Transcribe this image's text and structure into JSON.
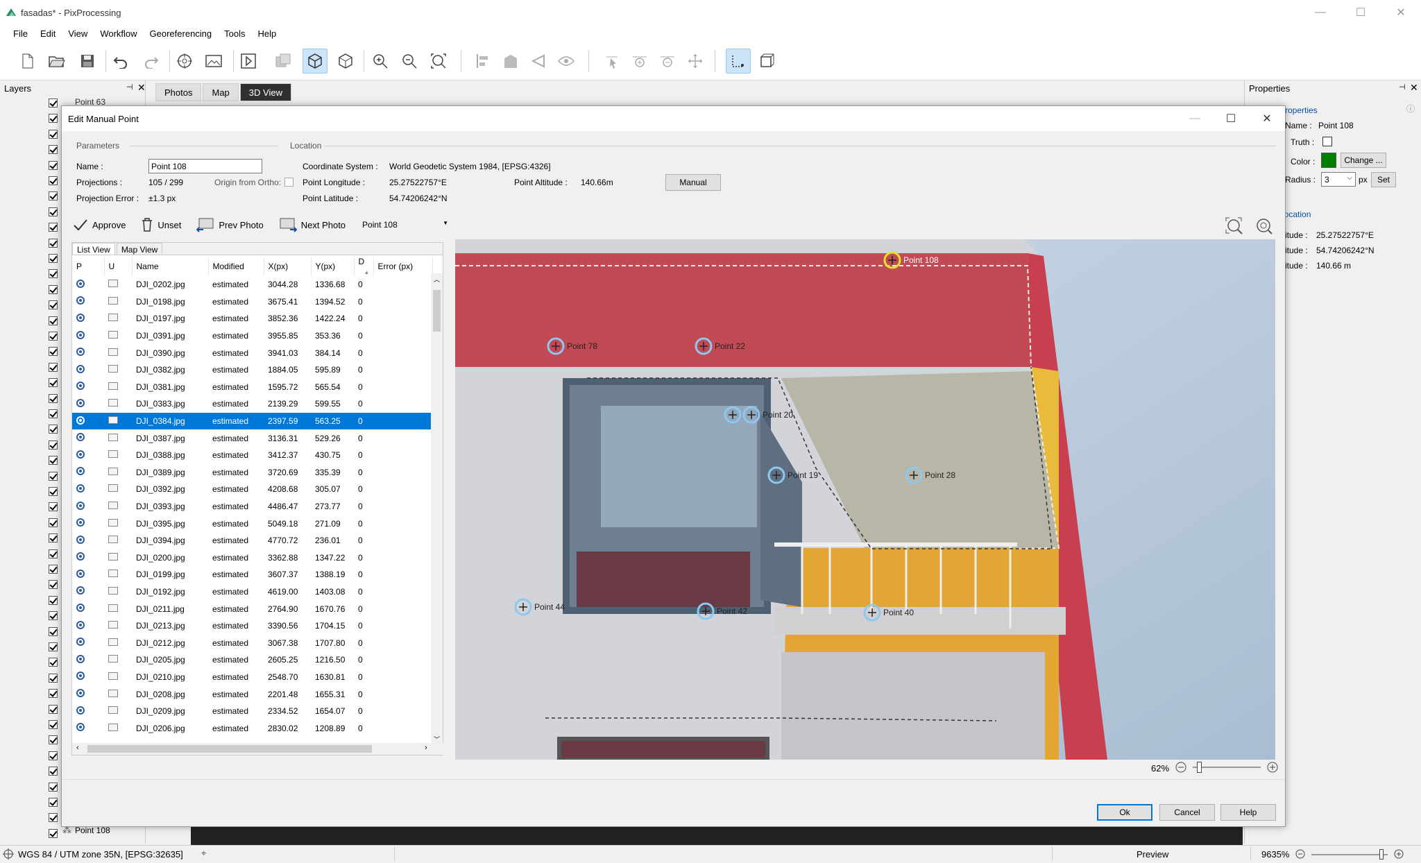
{
  "window": {
    "title": "fasadas* - PixProcessing",
    "min": "—",
    "max": "☐",
    "close": "✕"
  },
  "menu": [
    "File",
    "Edit",
    "View",
    "Workflow",
    "Georeferencing",
    "Tools",
    "Help"
  ],
  "layers": {
    "title": "Layers",
    "top_item": "Point 63",
    "bottom_item": "Point 108"
  },
  "view_tabs": [
    "Photos",
    "Map",
    "3D View"
  ],
  "properties": {
    "title": "Properties",
    "section": "Properties",
    "name_label": "Name :",
    "name_value": "Point 108",
    "truth_label": "Truth :",
    "color_label": "Color :",
    "color": "#008000",
    "change_label": "Change ...",
    "radius_label": "Radius :",
    "radius_value": "3",
    "radius_unit": "px",
    "set_label": "Set",
    "location_section": "Location",
    "lon_label": "itude :",
    "lon_value": "25.27522757°E",
    "lat_label": "itude :",
    "lat_value": "54.74206242°N",
    "alt_label": "itude :",
    "alt_value": "140.66 m"
  },
  "dialog": {
    "title": "Edit Manual Point",
    "parameters_label": "Parameters",
    "location_label": "Location",
    "name_label": "Name :",
    "name_value": "Point 108",
    "projections_label": "Projections :",
    "projections_value": "105 / 299",
    "origin_label": "Origin from Ortho:",
    "proj_error_label": "Projection Error :",
    "proj_error_value": "±1.3 px",
    "cs_label": "Coordinate System :",
    "cs_value": "World Geodetic System 1984, [EPSG:4326]",
    "lon_label": "Point Longitude :",
    "lon_value": "25.27522757°E",
    "lat_label": "Point Latitude :",
    "lat_value": "54.74206242°N",
    "alt_label": "Point Altitude :",
    "alt_value": "140.66m",
    "manual_button": "Manual",
    "approve": "Approve",
    "unset": "Unset",
    "prev_photo": "Prev Photo",
    "next_photo": "Next Photo",
    "point_select": "Point 108",
    "list_tabs": [
      "List View",
      "Map View"
    ],
    "columns": [
      "P",
      "U",
      "Name",
      "Modified",
      "X(px)",
      "Y(px)",
      "D",
      "Error (px)"
    ],
    "rows": [
      [
        "DJI_0202.jpg",
        "estimated",
        "3044.28",
        "1336.68",
        "0"
      ],
      [
        "DJI_0198.jpg",
        "estimated",
        "3675.41",
        "1394.52",
        "0"
      ],
      [
        "DJI_0197.jpg",
        "estimated",
        "3852.36",
        "1422.24",
        "0"
      ],
      [
        "DJI_0391.jpg",
        "estimated",
        "3955.85",
        "353.36",
        "0"
      ],
      [
        "DJI_0390.jpg",
        "estimated",
        "3941.03",
        "384.14",
        "0"
      ],
      [
        "DJI_0382.jpg",
        "estimated",
        "1884.05",
        "595.89",
        "0"
      ],
      [
        "DJI_0381.jpg",
        "estimated",
        "1595.72",
        "565.54",
        "0"
      ],
      [
        "DJI_0383.jpg",
        "estimated",
        "2139.29",
        "599.55",
        "0"
      ],
      [
        "DJI_0384.jpg",
        "estimated",
        "2397.59",
        "563.25",
        "0"
      ],
      [
        "DJI_0387.jpg",
        "estimated",
        "3136.31",
        "529.26",
        "0"
      ],
      [
        "DJI_0388.jpg",
        "estimated",
        "3412.37",
        "430.75",
        "0"
      ],
      [
        "DJI_0389.jpg",
        "estimated",
        "3720.69",
        "335.39",
        "0"
      ],
      [
        "DJI_0392.jpg",
        "estimated",
        "4208.68",
        "305.07",
        "0"
      ],
      [
        "DJI_0393.jpg",
        "estimated",
        "4486.47",
        "273.77",
        "0"
      ],
      [
        "DJI_0395.jpg",
        "estimated",
        "5049.18",
        "271.09",
        "0"
      ],
      [
        "DJI_0394.jpg",
        "estimated",
        "4770.72",
        "236.01",
        "0"
      ],
      [
        "DJI_0200.jpg",
        "estimated",
        "3362.88",
        "1347.22",
        "0"
      ],
      [
        "DJI_0199.jpg",
        "estimated",
        "3607.37",
        "1388.19",
        "0"
      ],
      [
        "DJI_0192.jpg",
        "estimated",
        "4619.00",
        "1403.08",
        "0"
      ],
      [
        "DJI_0211.jpg",
        "estimated",
        "2764.90",
        "1670.76",
        "0"
      ],
      [
        "DJI_0213.jpg",
        "estimated",
        "3390.56",
        "1704.15",
        "0"
      ],
      [
        "DJI_0212.jpg",
        "estimated",
        "3067.38",
        "1707.80",
        "0"
      ],
      [
        "DJI_0205.jpg",
        "estimated",
        "2605.25",
        "1216.50",
        "0"
      ],
      [
        "DJI_0210.jpg",
        "estimated",
        "2548.70",
        "1630.81",
        "0"
      ],
      [
        "DJI_0208.jpg",
        "estimated",
        "2201.48",
        "1655.31",
        "0"
      ],
      [
        "DJI_0209.jpg",
        "estimated",
        "2334.52",
        "1654.07",
        "0"
      ],
      [
        "DJI_0206.jpg",
        "estimated",
        "2830.02",
        "1208.89",
        "0"
      ]
    ],
    "selected_row": 8,
    "photo_points": [
      "Point 108",
      "Point 78",
      "Point 22",
      "Point 20",
      "Point 19",
      "Point 28",
      "Point 44",
      "Point 42",
      "Point 40"
    ],
    "zoom": "62%",
    "ok": "Ok",
    "cancel": "Cancel",
    "help": "Help"
  },
  "status": {
    "crs": "WGS 84 / UTM zone 35N, [EPSG:32635]",
    "preview": "Preview",
    "zoom": "9635%"
  }
}
